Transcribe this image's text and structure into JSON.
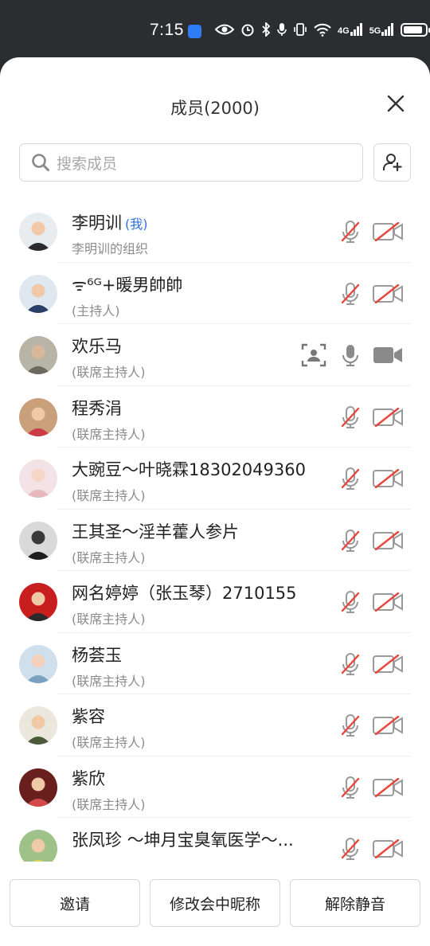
{
  "status_bar": {
    "time": "7:15",
    "net1": "4G",
    "net2": "5G",
    "icons": [
      "messenger-icon",
      "eye-icon",
      "alarm-icon",
      "bluetooth-icon",
      "mic-icon",
      "vibrate-icon",
      "wifi-icon",
      "signal-icon",
      "signal-icon",
      "battery-icon"
    ]
  },
  "header": {
    "title": "成员(2000)"
  },
  "search": {
    "placeholder": "搜索成员"
  },
  "members": [
    {
      "name": "李明训",
      "tag": "(我)",
      "role": "李明训的组织",
      "mic": "muted",
      "cam": "off"
    },
    {
      "name": "ᯤ⁶ᴳ+暖男帥帥",
      "role": "(主持人)",
      "mic": "muted",
      "cam": "off"
    },
    {
      "name": "欢乐马",
      "role": "(联席主持人)",
      "mic": "on",
      "cam": "on",
      "sharing": true
    },
    {
      "name": "程秀涓",
      "role": "(联席主持人)",
      "mic": "muted",
      "cam": "off"
    },
    {
      "name": "大豌豆～叶晓霖18302049360",
      "role": "(联席主持人)",
      "mic": "muted",
      "cam": "off"
    },
    {
      "name": "王其圣～淫羊藿人参片",
      "role": "(联席主持人)",
      "mic": "muted",
      "cam": "off"
    },
    {
      "name": "网名婷婷（张玉琴）2710155",
      "role": "(联席主持人)",
      "mic": "muted",
      "cam": "off"
    },
    {
      "name": "杨荟玉",
      "role": "(联席主持人)",
      "mic": "muted",
      "cam": "off"
    },
    {
      "name": "紫容",
      "role": "(联席主持人)",
      "mic": "muted",
      "cam": "off"
    },
    {
      "name": "紫欣",
      "role": "(联席主持人)",
      "mic": "muted",
      "cam": "off"
    },
    {
      "name": " 张凤珍 ～坤月宝臭氧医学～...",
      "role": "",
      "mic": "muted",
      "cam": "off"
    }
  ],
  "footer": {
    "invite": "邀请",
    "rename": "修改会中昵称",
    "unmute": "解除静音"
  },
  "colors": {
    "accent": "#2f6fe0",
    "muted_slash": "#e8453c",
    "icon_gray": "#8a8a8a",
    "status_bar": "#2b2d31"
  }
}
